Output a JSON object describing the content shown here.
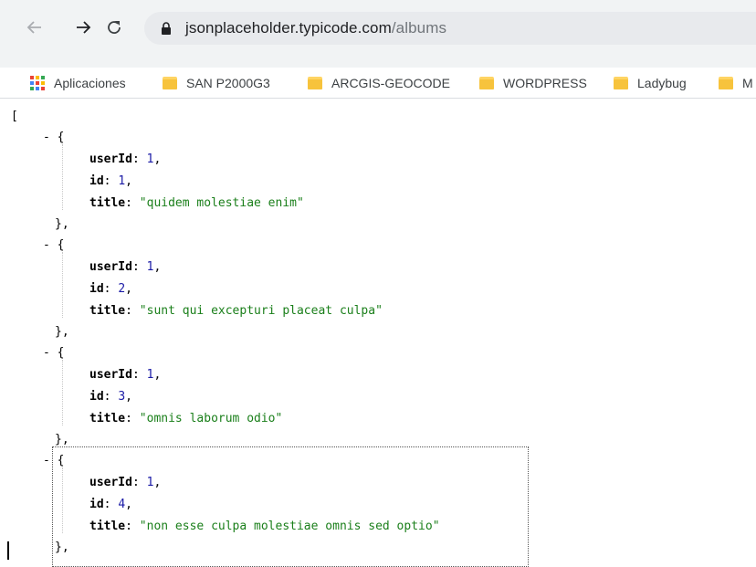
{
  "browser": {
    "back_icon": "arrow-left-icon",
    "forward_icon": "arrow-right-icon",
    "reload_icon": "reload-icon",
    "lock_icon": "lock-icon",
    "url_host": "jsonplaceholder.typicode.com",
    "url_path": "/albums"
  },
  "bookmarks": {
    "apps_label": "Aplicaciones",
    "items": [
      {
        "label": "SAN P2000G3"
      },
      {
        "label": "ARCGIS-GEOCODE"
      },
      {
        "label": "WORDPRESS"
      },
      {
        "label": "Ladybug"
      },
      {
        "label": "M"
      }
    ]
  },
  "json_view": {
    "open_bracket": "[",
    "collapser": "-",
    "open_brace": "{",
    "close_brace": "},",
    "keys": {
      "userId": "userId",
      "id": "id",
      "title": "title"
    },
    "albums": [
      {
        "userId": "1",
        "id": "1",
        "title": "\"quidem molestiae enim\""
      },
      {
        "userId": "1",
        "id": "2",
        "title": "\"sunt qui excepturi placeat culpa\""
      },
      {
        "userId": "1",
        "id": "3",
        "title": "\"omnis laborum odio\""
      },
      {
        "userId": "1",
        "id": "4",
        "title": "\"non esse culpa molestiae omnis sed optio\""
      }
    ]
  },
  "colors": {
    "key": "#000000",
    "number": "#1a1aa6",
    "string": "#1a7f1a",
    "folder": "#f7c33c"
  }
}
